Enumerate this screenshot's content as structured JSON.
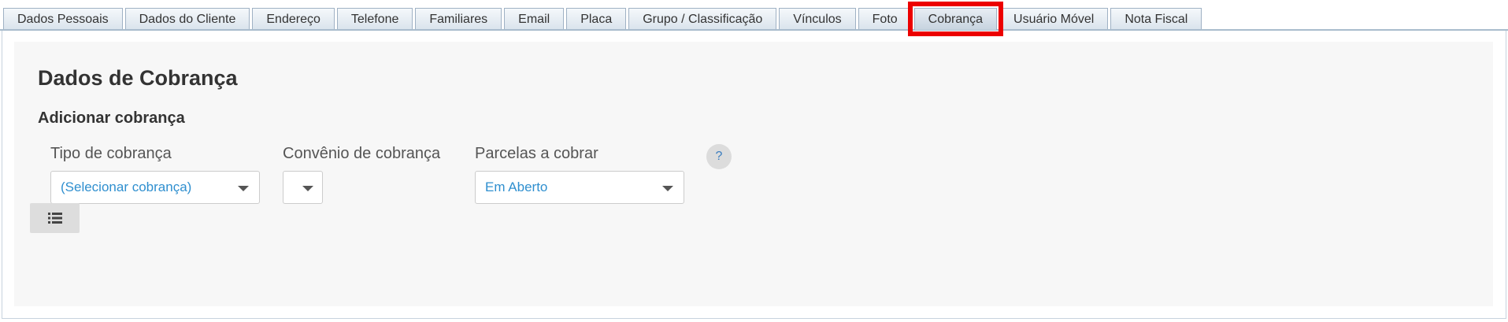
{
  "tabs": [
    {
      "label": "Dados Pessoais",
      "active": false
    },
    {
      "label": "Dados do Cliente",
      "active": false
    },
    {
      "label": "Endereço",
      "active": false
    },
    {
      "label": "Telefone",
      "active": false
    },
    {
      "label": "Familiares",
      "active": false
    },
    {
      "label": "Email",
      "active": false
    },
    {
      "label": "Placa",
      "active": false
    },
    {
      "label": "Grupo / Classificação",
      "active": false
    },
    {
      "label": "Vínculos",
      "active": false
    },
    {
      "label": "Foto",
      "active": false
    },
    {
      "label": "Cobrança",
      "active": true
    },
    {
      "label": "Usuário Móvel",
      "active": false
    },
    {
      "label": "Nota Fiscal",
      "active": false
    }
  ],
  "section": {
    "title": "Dados de Cobrança",
    "subtitle": "Adicionar cobrança"
  },
  "fields": {
    "tipo_cobranca": {
      "label": "Tipo de cobrança",
      "value": "(Selecionar cobrança)"
    },
    "convenio_cobranca": {
      "label": "Convênio de cobrança",
      "value": ""
    },
    "parcelas_cobrar": {
      "label": "Parcelas a cobrar",
      "value": "Em Aberto"
    }
  },
  "help": {
    "label": "?"
  },
  "icons": {
    "help": "question-icon",
    "list": "list-icon",
    "caret": "chevron-down-icon"
  },
  "colors": {
    "highlight": "#ec0000",
    "value_text": "#2f8fcf",
    "panel_bg": "#f7f7f7"
  }
}
